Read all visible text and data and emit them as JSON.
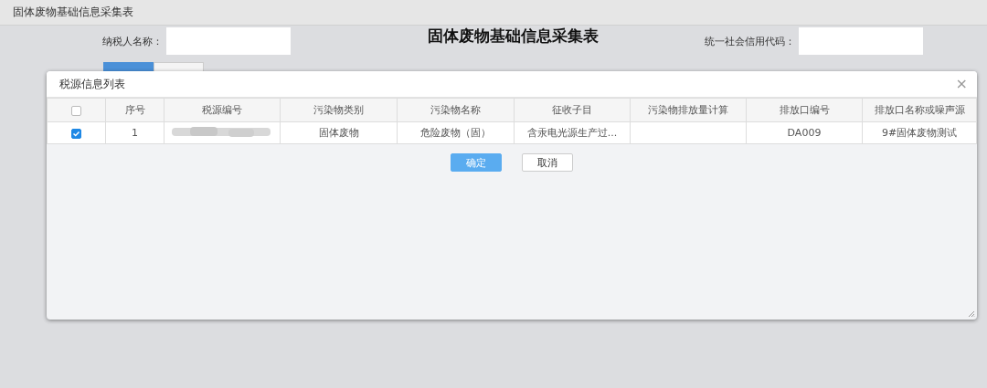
{
  "window": {
    "title": "固体废物基础信息采集表"
  },
  "form": {
    "heading": "固体废物基础信息采集表",
    "taxpayer_label": "纳税人名称：",
    "credit_code_label": "统一社会信用代码：",
    "buttons": [
      {
        "kind": "primary"
      },
      {
        "kind": "default"
      }
    ]
  },
  "dialog": {
    "title": "税源信息列表",
    "close": "×",
    "table": {
      "header_checked": false,
      "columns": [
        "序号",
        "税源编号",
        "污染物类别",
        "污染物名称",
        "征收子目",
        "污染物排放量计算",
        "排放口编号",
        "排放口名称或噪声源"
      ],
      "rows": [
        {
          "checked": true,
          "cells": [
            {
              "kind": "text",
              "text": "1"
            },
            {
              "kind": "redacted"
            },
            {
              "kind": "text",
              "text": "固体废物"
            },
            {
              "kind": "text",
              "text": "危险废物（固）"
            },
            {
              "kind": "text",
              "text": "含汞电光源生产过..."
            },
            {
              "kind": "empty"
            },
            {
              "kind": "text",
              "text": "DA009"
            },
            {
              "kind": "text",
              "text": "9#固体废物测试"
            }
          ]
        }
      ]
    },
    "buttons": [
      {
        "label": "确定",
        "kind": "primary"
      },
      {
        "label": "取消",
        "kind": "default"
      }
    ]
  }
}
